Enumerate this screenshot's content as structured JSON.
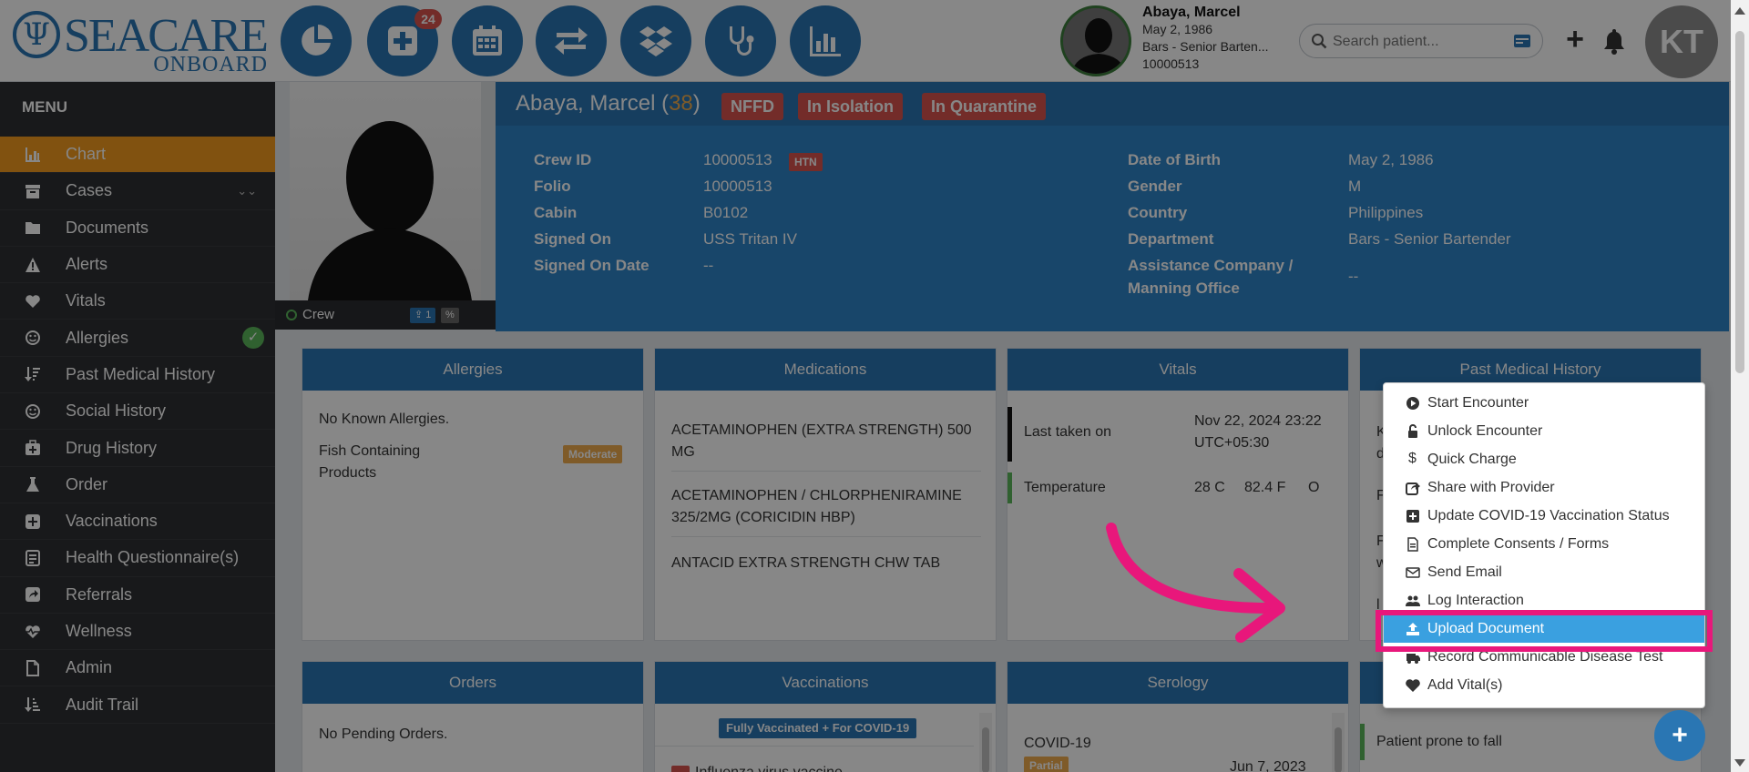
{
  "app": {
    "logo_text": "SEACARE",
    "logo_sub": "ONBOARD",
    "notif_badge": "24"
  },
  "topbar": {
    "patient_name": "Abaya, Marcel",
    "patient_dob": "May 2, 1986",
    "patient_dept": "Bars - Senior Barten...",
    "patient_id": "10000513",
    "search_placeholder": "Search patient...",
    "user_initials": "KT"
  },
  "sidebar": {
    "title": "MENU",
    "items": [
      {
        "label": "Chart",
        "icon": "bar-chart-icon"
      },
      {
        "label": "Cases",
        "icon": "archive-icon"
      },
      {
        "label": "Documents",
        "icon": "folder-icon"
      },
      {
        "label": "Alerts",
        "icon": "warning-icon"
      },
      {
        "label": "Vitals",
        "icon": "heart-icon"
      },
      {
        "label": "Allergies",
        "icon": "smile-icon"
      },
      {
        "label": "Past Medical History",
        "icon": "sort-icon"
      },
      {
        "label": "Social History",
        "icon": "smile-icon"
      },
      {
        "label": "Drug History",
        "icon": "medkit-icon"
      },
      {
        "label": "Order",
        "icon": "flask-icon"
      },
      {
        "label": "Vaccinations",
        "icon": "plus-square-icon"
      },
      {
        "label": "Health Questionnaire(s)",
        "icon": "form-icon"
      },
      {
        "label": "Referrals",
        "icon": "share-icon"
      },
      {
        "label": "Wellness",
        "icon": "heartbeat-icon"
      },
      {
        "label": "Admin",
        "icon": "file-icon"
      },
      {
        "label": "Audit Trail",
        "icon": "sort-amount-icon"
      }
    ]
  },
  "photo": {
    "role": "Crew",
    "tag1": "1"
  },
  "header": {
    "name": "Abaya, Marcel",
    "age": "38",
    "tags": [
      "NFFD",
      "In Isolation",
      "In Quarantine"
    ],
    "htn_tag": "HTN",
    "left_labels": [
      "Crew ID",
      "Folio",
      "Cabin",
      "Signed On",
      "Signed On Date"
    ],
    "left_values": [
      "10000513",
      "10000513",
      "B0102",
      "USS Tritan IV",
      "--"
    ],
    "right_labels": [
      "Date of Birth",
      "Gender",
      "Country",
      "Department",
      "Assistance Company /",
      "Manning Office"
    ],
    "right_values": [
      "May 2, 1986",
      "M",
      "Philippines",
      "Bars - Senior Bartender",
      "--"
    ]
  },
  "cards": {
    "allergies": {
      "title": "Allergies",
      "none": "No Known Allergies.",
      "item": "Fish Containing Products",
      "severity": "Moderate"
    },
    "medications": {
      "title": "Medications",
      "items": [
        "ACETAMINOPHEN (EXTRA STRENGTH) 500 MG",
        "ACETAMINOPHEN / CHLORPHENIRAMINE 325/2MG (CORICIDIN HBP)",
        "ANTACID EXTRA STRENGTH CHW TAB"
      ]
    },
    "vitals": {
      "title": "Vitals",
      "last_label": "Last taken on",
      "last_value": "Nov 22, 2024 23:22 UTC+05:30",
      "temp_label": "Temperature",
      "temp_c": "28 C",
      "temp_f": "82.4 F",
      "temp_o": "O"
    },
    "pmh": {
      "title": "Past Medical History",
      "partial": [
        "K",
        "d",
        "F",
        "F",
        "w",
        "l"
      ]
    },
    "orders": {
      "title": "Orders",
      "none": "No Pending Orders."
    },
    "vaccinations": {
      "title": "Vaccinations",
      "badge": "Fully Vaccinated + For COVID-19",
      "item": "Influenza virus vaccine"
    },
    "serology": {
      "title": "Serology",
      "item": "COVID-19",
      "status": "Partial",
      "date": "Jun 7, 2023"
    },
    "alerts": {
      "item": "Patient prone to fall"
    }
  },
  "dropdown": {
    "items": [
      {
        "label": "Start Encounter",
        "icon": "play-circle-icon"
      },
      {
        "label": "Unlock Encounter",
        "icon": "unlock-icon"
      },
      {
        "label": "Quick Charge",
        "icon": "dollar-icon"
      },
      {
        "label": "Share with Provider",
        "icon": "share-square-icon"
      },
      {
        "label": "Update COVID-19 Vaccination Status",
        "icon": "plus-square-icon"
      },
      {
        "label": "Complete Consents / Forms",
        "icon": "file-text-icon"
      },
      {
        "label": "Send Email",
        "icon": "envelope-icon"
      },
      {
        "label": "Log Interaction",
        "icon": "users-icon"
      },
      {
        "label": "Upload Document",
        "icon": "upload-icon"
      },
      {
        "label": "Record Communicable Disease Test",
        "icon": "ambulance-icon"
      },
      {
        "label": "Add Vital(s)",
        "icon": "heart-icon"
      }
    ],
    "highlighted_index": 8
  },
  "colors": {
    "primary": "#2a76b3",
    "accent": "#f49c1f",
    "danger": "#d9534f",
    "highlight": "#e8177b",
    "menu_highlight": "#3aa0e0"
  }
}
